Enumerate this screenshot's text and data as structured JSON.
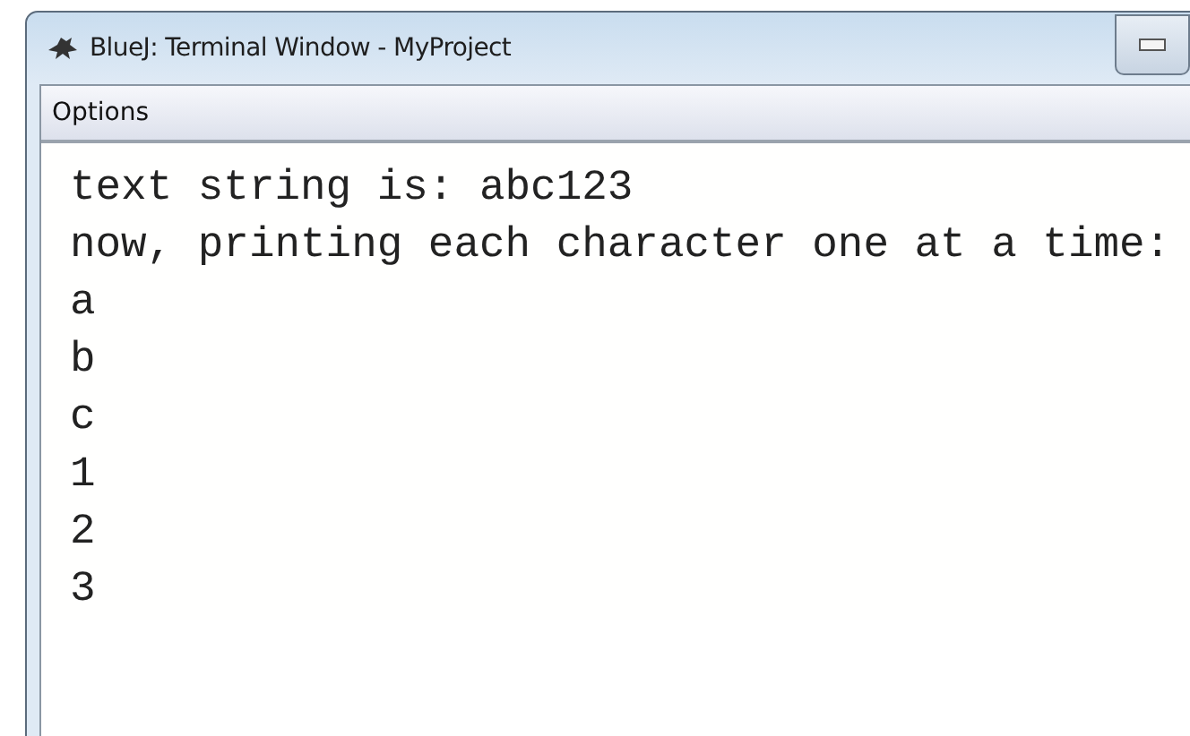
{
  "window": {
    "title": "BlueJ: Terminal Window - MyProject"
  },
  "menu_bar": {
    "items": [
      {
        "label": "Options"
      }
    ]
  },
  "terminal": {
    "lines": [
      "text string is: abc123",
      "now, printing each character one at a time:",
      "a",
      "b",
      "c",
      "1",
      "2",
      "3"
    ]
  }
}
